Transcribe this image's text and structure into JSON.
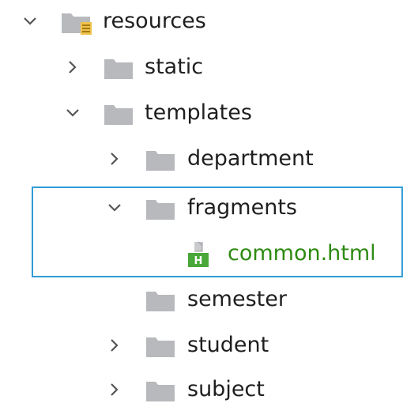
{
  "tree": {
    "items": [
      {
        "label": "resources",
        "type": "resources-folder",
        "expanded": true
      },
      {
        "label": "static",
        "type": "folder",
        "expanded": false
      },
      {
        "label": "templates",
        "type": "folder",
        "expanded": true
      },
      {
        "label": "department",
        "type": "folder",
        "expanded": false
      },
      {
        "label": "fragments",
        "type": "folder",
        "expanded": true
      },
      {
        "label": "common.html",
        "type": "html-file"
      },
      {
        "label": "semester",
        "type": "folder"
      },
      {
        "label": "student",
        "type": "folder",
        "expanded": false
      },
      {
        "label": "subject",
        "type": "folder",
        "expanded": false
      }
    ]
  },
  "colors": {
    "selection_border": "#2e9cd6",
    "folder": "#b7b9bc",
    "file_text": "#2d8a12",
    "text": "#1f1f1f"
  }
}
